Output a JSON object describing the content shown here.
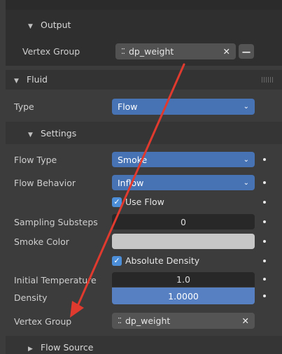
{
  "output_section": {
    "title": "Output",
    "vertex_group_label": "Vertex Group",
    "vertex_group_value": "dp_weight"
  },
  "fluid_section": {
    "title": "Fluid",
    "type_label": "Type",
    "type_value": "Flow"
  },
  "settings_section": {
    "title": "Settings",
    "flow_type_label": "Flow Type",
    "flow_type_value": "Smoke",
    "flow_behavior_label": "Flow Behavior",
    "flow_behavior_value": "Inflow",
    "use_flow_label": "Use Flow",
    "sampling_substeps_label": "Sampling Substeps",
    "sampling_substeps_value": "0",
    "smoke_color_label": "Smoke Color",
    "smoke_color_hex": "#c7c7c7",
    "absolute_density_label": "Absolute Density",
    "initial_temperature_label": "Initial Temperature",
    "initial_temperature_value": "1.0",
    "density_label": "Density",
    "density_value": "1.0000",
    "vertex_group_label": "Vertex Group",
    "vertex_group_value": "dp_weight"
  },
  "flow_source_section": {
    "title": "Flow Source"
  },
  "colors": {
    "accent_blue": "#4772b3",
    "annotation_red": "#e03a2f"
  }
}
